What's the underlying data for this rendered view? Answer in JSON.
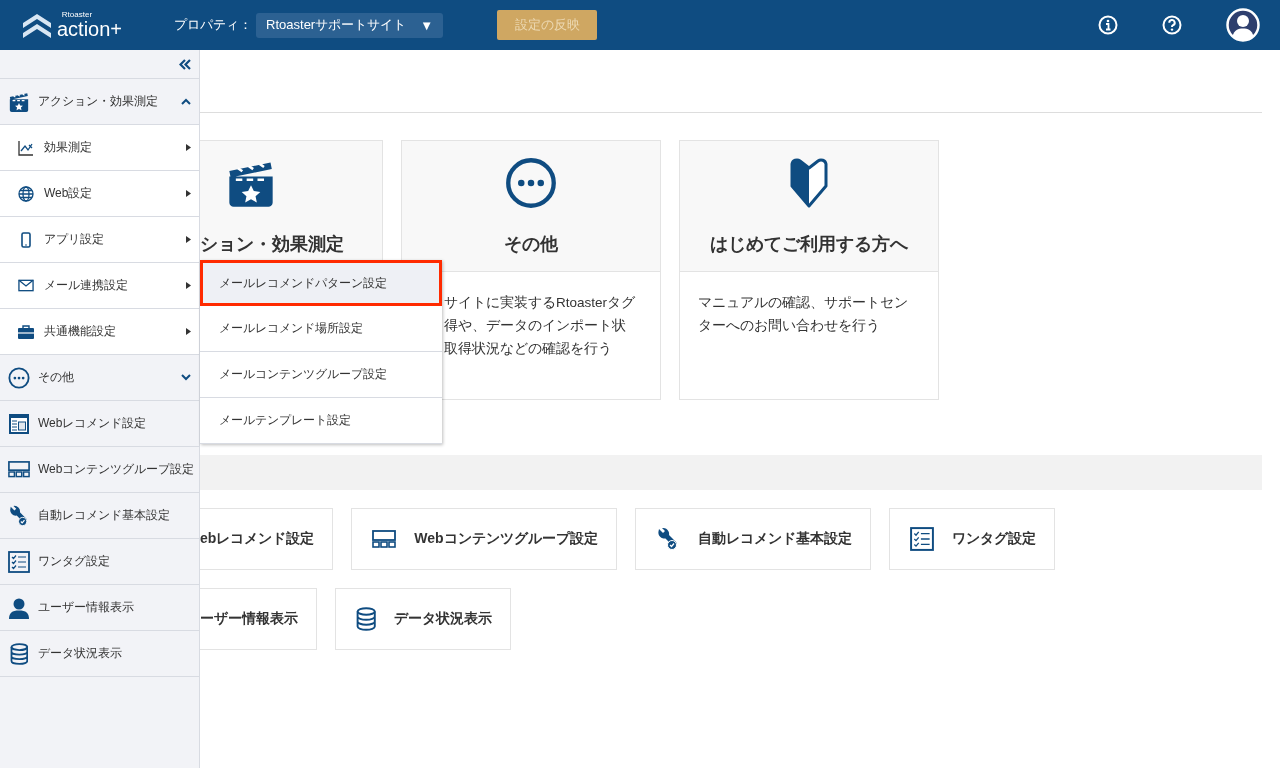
{
  "header": {
    "logo": {
      "small": "Rtoaster",
      "main": "action+"
    },
    "property_label": "プロパティ：",
    "property_select": {
      "value": "Rtoasterサポートサイト",
      "caret": "▼"
    },
    "apply_button": {
      "label": "設定の反映",
      "disabled": true
    }
  },
  "sidebar": {
    "items": [
      {
        "kind": "section",
        "label": "アクション・効果測定",
        "expanded": true,
        "children": [
          {
            "label": "効果測定"
          },
          {
            "label": "Web設定"
          },
          {
            "label": "アプリ設定"
          },
          {
            "label": "メール連携設定"
          },
          {
            "label": "共通機能設定"
          }
        ]
      },
      {
        "kind": "section",
        "label": "その他",
        "expanded": false
      },
      {
        "kind": "link",
        "label": "Webレコメンド設定"
      },
      {
        "kind": "link",
        "label": "Webコンテンツグループ設定"
      },
      {
        "kind": "link",
        "label": "自動レコメンド基本設定"
      },
      {
        "kind": "link",
        "label": "ワンタグ設定"
      },
      {
        "kind": "link",
        "label": "ユーザー情報表示"
      },
      {
        "kind": "link",
        "label": "データ状況表示"
      }
    ]
  },
  "flyout_menu": {
    "items": [
      {
        "label": "メールレコメンドパターン設定",
        "selected": true
      },
      {
        "label": "メールレコメンド場所設定",
        "selected": false
      },
      {
        "label": "メールコンテンツグループ設定",
        "selected": false
      },
      {
        "label": "メールテンプレート設定",
        "selected": false
      }
    ]
  },
  "cards": [
    {
      "title": "ション・効果測定"
    },
    {
      "title": "その他",
      "lines": [
        "サイトに実装するRtoasterタグ",
        "得や、データのインポート状",
        "取得状況などの確認を行う"
      ]
    },
    {
      "title": "はじめてご利用する方へ",
      "lines": [
        "マニュアルの確認、サポートセン",
        "ターへのお問い合わせを行う"
      ]
    }
  ],
  "shortcuts": [
    [
      {
        "label": "ebレコメンド設定"
      },
      {
        "label": "Webコンテンツグループ設定"
      },
      {
        "label": "自動レコメンド基本設定"
      },
      {
        "label": "ワンタグ設定"
      }
    ],
    [
      {
        "label": "ーザー情報表示"
      },
      {
        "label": "データ状況表示"
      }
    ]
  ]
}
